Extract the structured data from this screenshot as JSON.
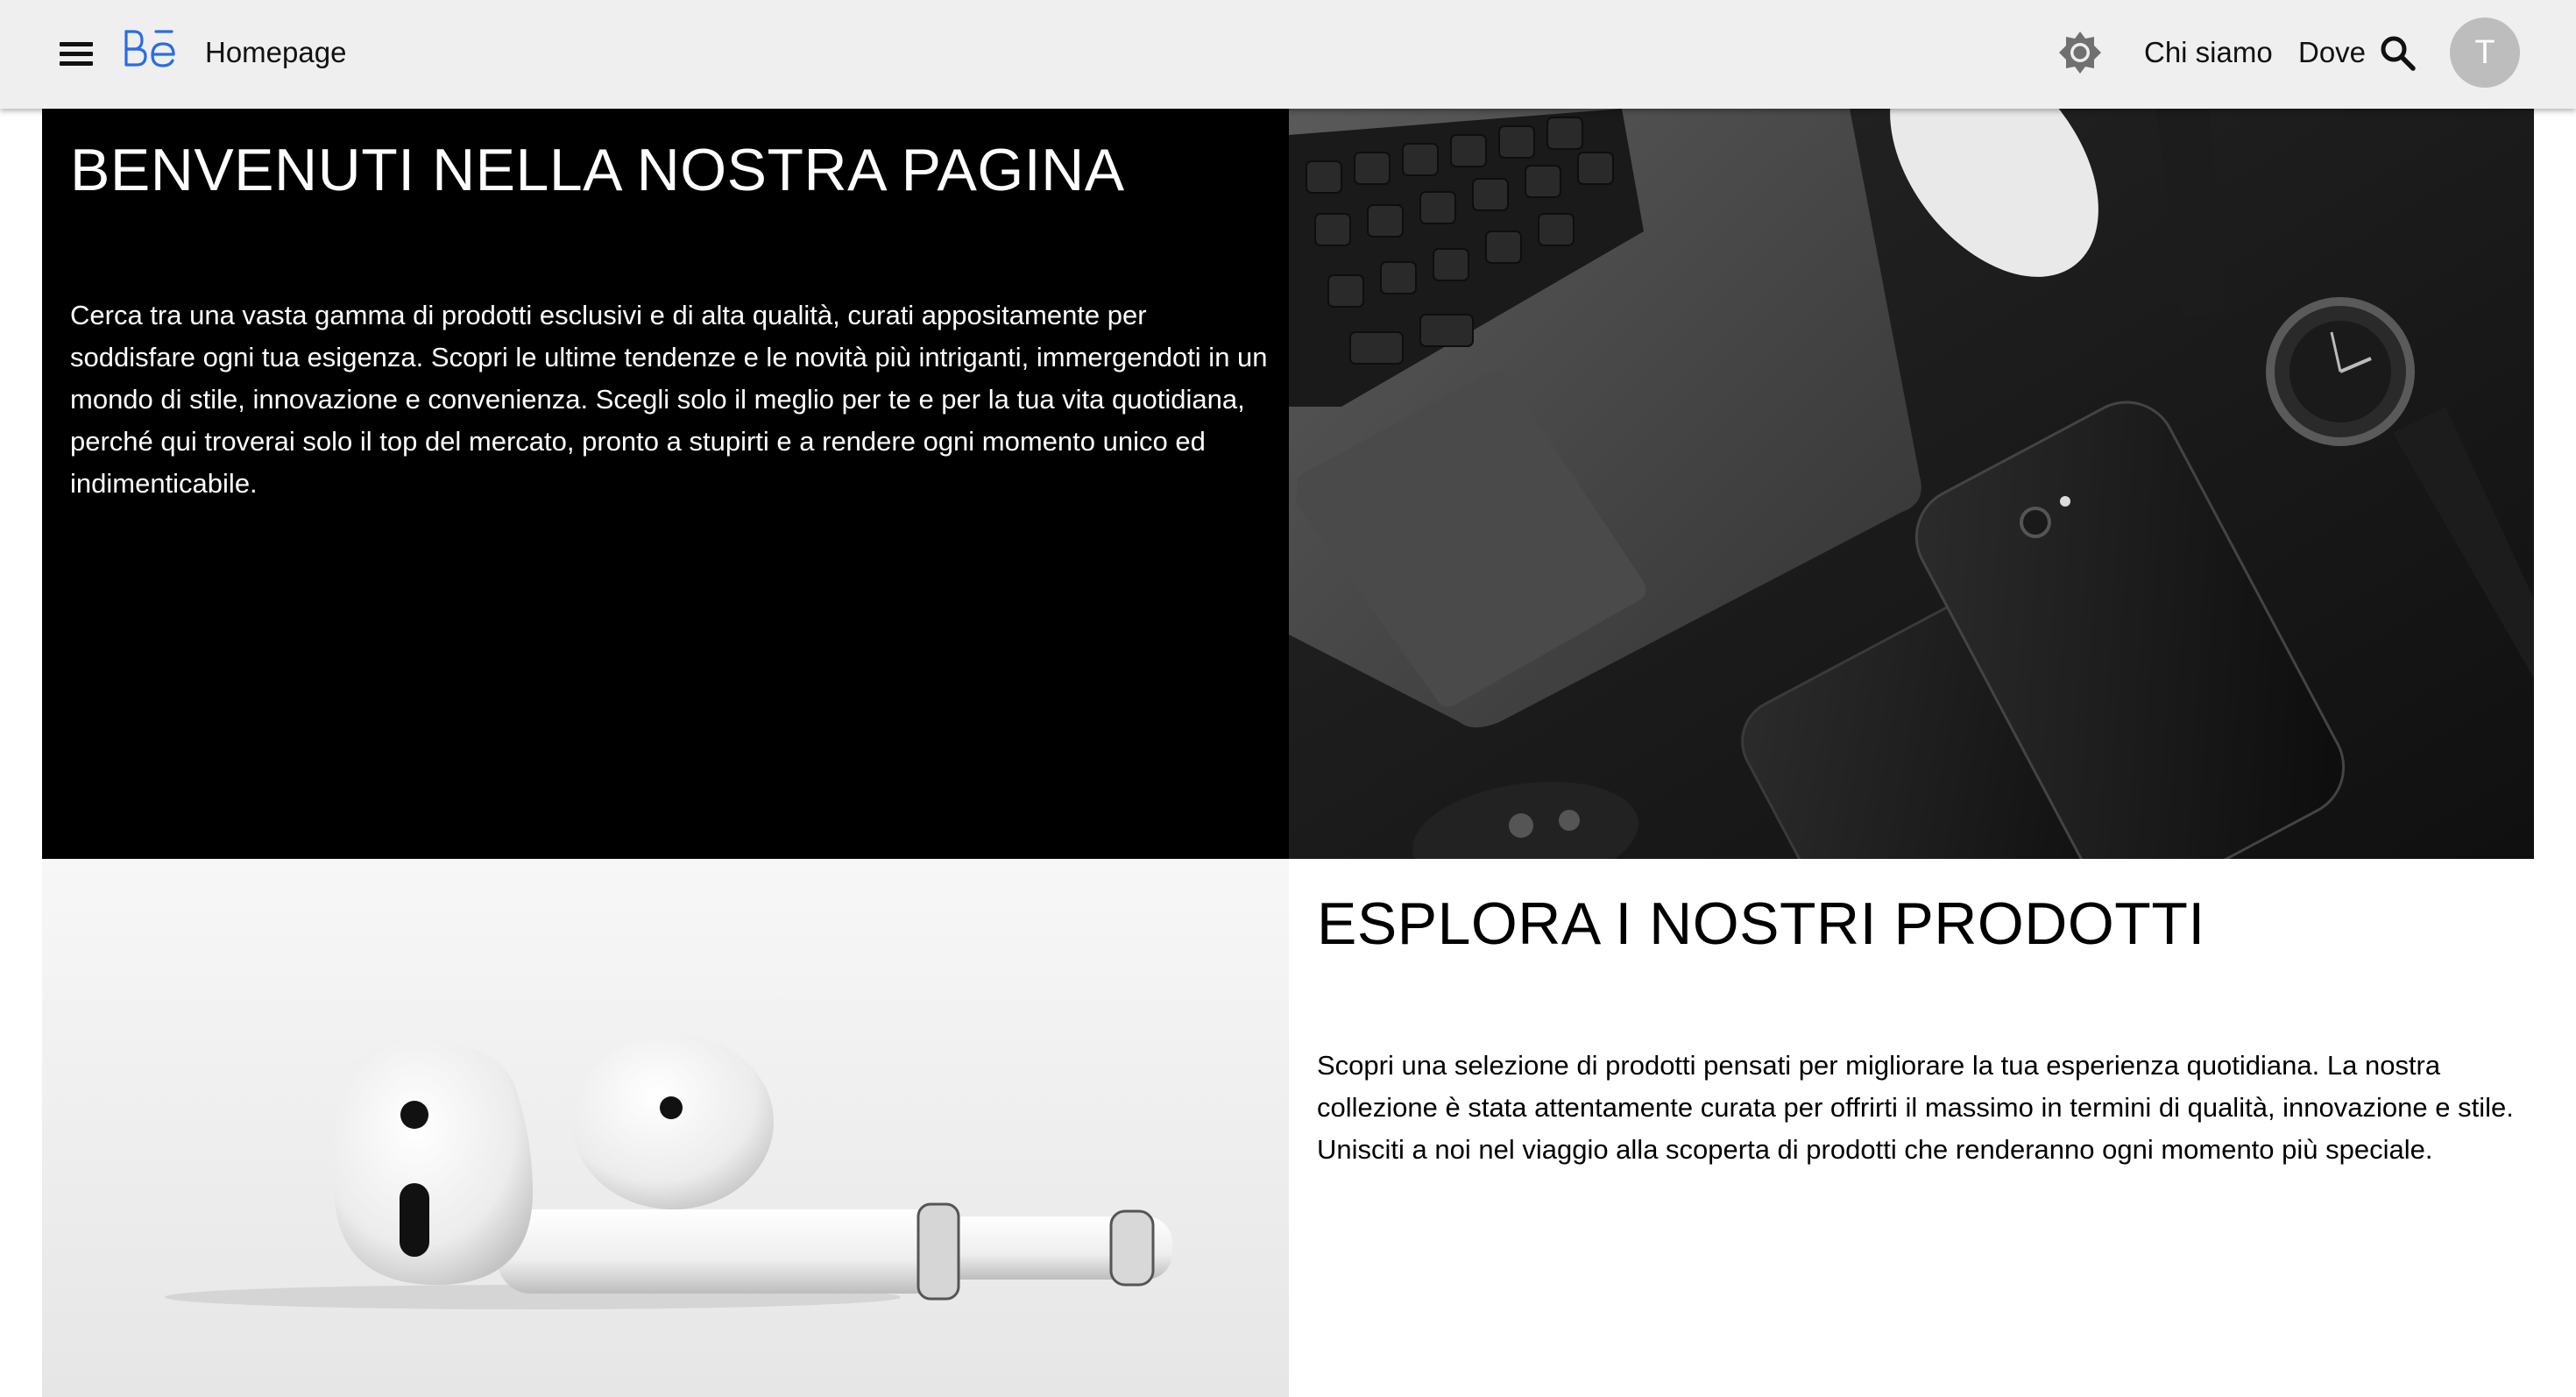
{
  "header": {
    "menu_icon": "hamburger-menu-icon",
    "logo_icon": "behance-logo-icon",
    "title": "Homepage",
    "theme_icon": "brightness-icon",
    "nav": [
      {
        "label": "Chi siamo"
      },
      {
        "label": "Dove"
      }
    ],
    "search_icon": "search-icon",
    "avatar_initial": "T"
  },
  "hero": {
    "title": "BENVENUTI NELLA NOSTRA PAGINA",
    "text": "Cerca tra una vasta gamma di prodotti esclusivi e di alta qualità, curati appositamente per soddisfare ogni tua esigenza. Scopri le ultime tendenze e le novità più intriganti, immergendoti in un mondo di stile, innovazione e convenienza. Scegli solo il meglio per te e per la tua vita quotidiana, perché qui troverai solo il top del mercato, pronto a stupirti e a rendere ogni momento unico ed indimenticabile."
  },
  "products": {
    "title": "ESPLORA I NOSTRI PRODOTTI",
    "text": "Scopri una selezione di prodotti pensati per migliorare la tua esperienza quotidiana. La nostra collezione è stata attentamente curata per offrirti il massimo in termini di qualità, innovazione e stile. Unisciti a noi nel viaggio alla scoperta di prodotti che renderanno ogni momento più speciale."
  },
  "colors": {
    "appbar_bg": "#efefef",
    "logo_blue": "#1769ff",
    "avatar_bg": "#bdbdbd",
    "hero_bg": "#000000"
  }
}
